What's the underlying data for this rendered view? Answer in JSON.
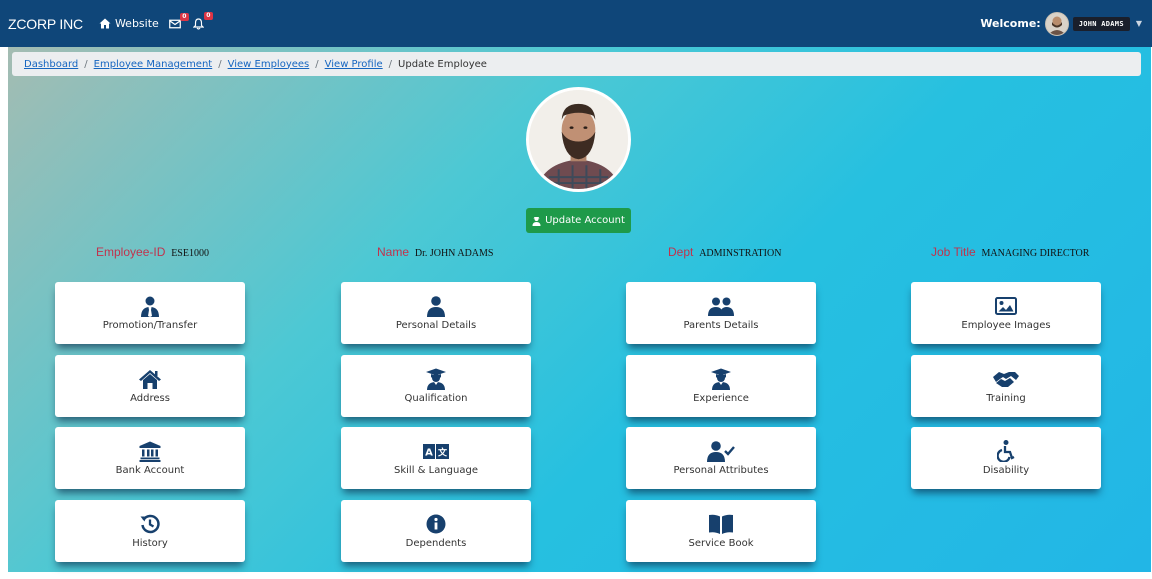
{
  "navbar": {
    "brand": "ZCORP INC",
    "website_label": "Website",
    "mail_count": "0",
    "notify_count": "0",
    "welcome_label": "Welcome:",
    "username": "JOHN ADAMS"
  },
  "breadcrumb": {
    "items": [
      "Dashboard",
      "Employee Management",
      "View Employees",
      "View Profile"
    ],
    "current": "Update Employee"
  },
  "profile": {
    "update_button": "Update Account",
    "fields": [
      {
        "label": "Employee-ID",
        "value": "ESE1000"
      },
      {
        "label": "Name",
        "value": "Dr. JOHN ADAMS"
      },
      {
        "label": "Dept",
        "value": "ADMINSTRATION"
      },
      {
        "label": "Job Title",
        "value": "MANAGING DIRECTOR"
      }
    ]
  },
  "cards": [
    {
      "label": "Promotion/Transfer",
      "icon": "user-tie-icon"
    },
    {
      "label": "Personal Details",
      "icon": "user-icon"
    },
    {
      "label": "Parents Details",
      "icon": "users-icon"
    },
    {
      "label": "Employee Images",
      "icon": "image-icon"
    },
    {
      "label": "Address",
      "icon": "home-icon"
    },
    {
      "label": "Qualification",
      "icon": "graduate-icon"
    },
    {
      "label": "Experience",
      "icon": "graduate-icon"
    },
    {
      "label": "Training",
      "icon": "handshake-icon"
    },
    {
      "label": "Bank Account",
      "icon": "bank-icon"
    },
    {
      "label": "Skill & Language",
      "icon": "language-icon"
    },
    {
      "label": "Personal Attributes",
      "icon": "user-check-icon"
    },
    {
      "label": "Disability",
      "icon": "wheelchair-icon"
    },
    {
      "label": "History",
      "icon": "history-icon"
    },
    {
      "label": "Dependents",
      "icon": "info-circle-icon"
    },
    {
      "label": "Service Book",
      "icon": "book-icon"
    }
  ],
  "colors": {
    "navbar": "#0f4679",
    "icon": "#17406d",
    "update_button": "#1e9a4a",
    "field_label": "#c0334d",
    "badge": "#dc3545"
  }
}
